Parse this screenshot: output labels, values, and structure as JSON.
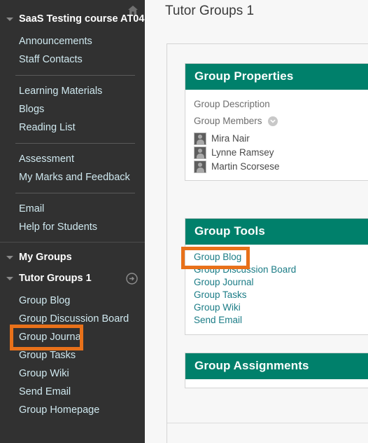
{
  "sidebar": {
    "course_title": "SaaS Testing course AT04",
    "home_icon": "home-icon",
    "top_items": [
      {
        "label": "Announcements"
      },
      {
        "label": "Staff Contacts"
      }
    ],
    "materials_items": [
      {
        "label": "Learning Materials"
      },
      {
        "label": "Blogs"
      },
      {
        "label": "Reading List"
      }
    ],
    "assessment_items": [
      {
        "label": "Assessment"
      },
      {
        "label": "My Marks and Feedback"
      }
    ],
    "support_items": [
      {
        "label": "Email"
      },
      {
        "label": "Help for Students"
      }
    ],
    "my_groups_label": "My Groups",
    "tutor_group_label": "Tutor Groups 1",
    "tutor_group_arrow_icon": "arrow-right-circle-icon",
    "group_items": [
      {
        "label": "Group Blog"
      },
      {
        "label": "Group Discussion Board"
      },
      {
        "label": "Group Journal"
      },
      {
        "label": "Group Tasks"
      },
      {
        "label": "Group Wiki"
      },
      {
        "label": "Send Email"
      },
      {
        "label": "Group Homepage"
      }
    ]
  },
  "main": {
    "page_title": "Tutor Groups 1",
    "properties_panel": {
      "heading": "Group Properties",
      "description_label": "Group Description",
      "members_label": "Group Members",
      "members_toggle_icon": "chevron-down-circle-icon",
      "members": [
        {
          "name": "Mira Nair",
          "avatar_icon": "user-avatar-icon"
        },
        {
          "name": "Lynne Ramsey",
          "avatar_icon": "user-avatar-icon"
        },
        {
          "name": "Martin Scorsese",
          "avatar_icon": "user-avatar-icon"
        }
      ]
    },
    "tools_panel": {
      "heading": "Group Tools",
      "links": [
        {
          "label": "Group Blog"
        },
        {
          "label": "Group Discussion Board"
        },
        {
          "label": "Group Journal"
        },
        {
          "label": "Group Tasks"
        },
        {
          "label": "Group Wiki"
        },
        {
          "label": "Send Email"
        }
      ]
    },
    "assignments_panel": {
      "heading": "Group Assignments"
    }
  },
  "annotations": {
    "highlight_color": "#e8711a",
    "boxes": [
      {
        "target": "sidebar Group Blog"
      },
      {
        "target": "main Group Tools Group Blog"
      }
    ]
  },
  "colors": {
    "sidebar_bg": "#313131",
    "panel_header_teal": "#00806b",
    "link_teal": "#1b7c86",
    "sidebar_link": "#cfe8ef"
  }
}
